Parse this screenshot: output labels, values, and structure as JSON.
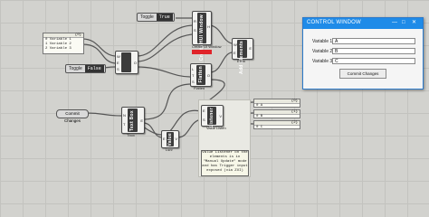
{
  "toggles": {
    "top": {
      "label": "Toggle",
      "value": "True"
    },
    "mid": {
      "label": "Toggle",
      "value": "False"
    }
  },
  "value_list": {
    "header": "{0}",
    "items": [
      "0 Variable 1",
      "1 Variable 2",
      "2 Variable 3"
    ]
  },
  "commit_param": {
    "label": "Commit Changes"
  },
  "components": {
    "c_top": {
      "name": "Create HUI Window",
      "ports_in": [
        "R",
        "S"
      ],
      "ports_out": [
        "H"
      ],
      "label": "Create UI Window"
    },
    "c_set": {
      "name": "Set",
      "ports_in": [
        "W",
        "E",
        "S"
      ],
      "ports_out": [
        "O"
      ]
    },
    "c_add": {
      "name": "Add Elements",
      "ports_in": [
        "W",
        "E"
      ],
      "ports_out": [
        "E"
      ],
      "label": "Elem"
    },
    "c_flatten": {
      "name": "Flatten",
      "ports_in": [
        "L",
        "T",
        "S"
      ],
      "ports_out": [
        "O"
      ],
      "label": "Flatten"
    },
    "c_textbox": {
      "name": "Text Box",
      "ports_in": [
        "N",
        "T"
      ],
      "ports_out": [
        "E"
      ],
      "label": "Tbox"
    },
    "c_value": {
      "name": "Value",
      "ports_in": [
        "E"
      ],
      "ports_out": [
        "V"
      ],
      "label": "Lsnr"
    },
    "c_listener": {
      "name": "Listener",
      "ports_in": [
        "E",
        "S"
      ],
      "ports_out": [
        "V"
      ],
      "label": "Value Listen"
    }
  },
  "output_panels": {
    "top": {
      "header": "{0}",
      "row": "0 A",
      "val": "A"
    },
    "panel_a": {
      "header": "{1}",
      "row": "0 B"
    },
    "panel_b": {
      "header": "{2}",
      "row": "0 C"
    }
  },
  "note": "Value Listener on the elements is in \"Manual Update\" mode and has Trigger input exposed (via ZUI)",
  "control_window": {
    "title": "CONTROL WINDOW",
    "buttons": {
      "minimize": "—",
      "maximize": "□",
      "close": "✕"
    },
    "fields": [
      {
        "label": "Variable 1",
        "value": "A"
      },
      {
        "label": "Variable 2",
        "value": "B"
      },
      {
        "label": "Variable 3",
        "value": "C"
      }
    ],
    "commit_label": "Commit Changes"
  },
  "colors": {
    "accent": "#1f8be8",
    "error": "#e0242a"
  }
}
